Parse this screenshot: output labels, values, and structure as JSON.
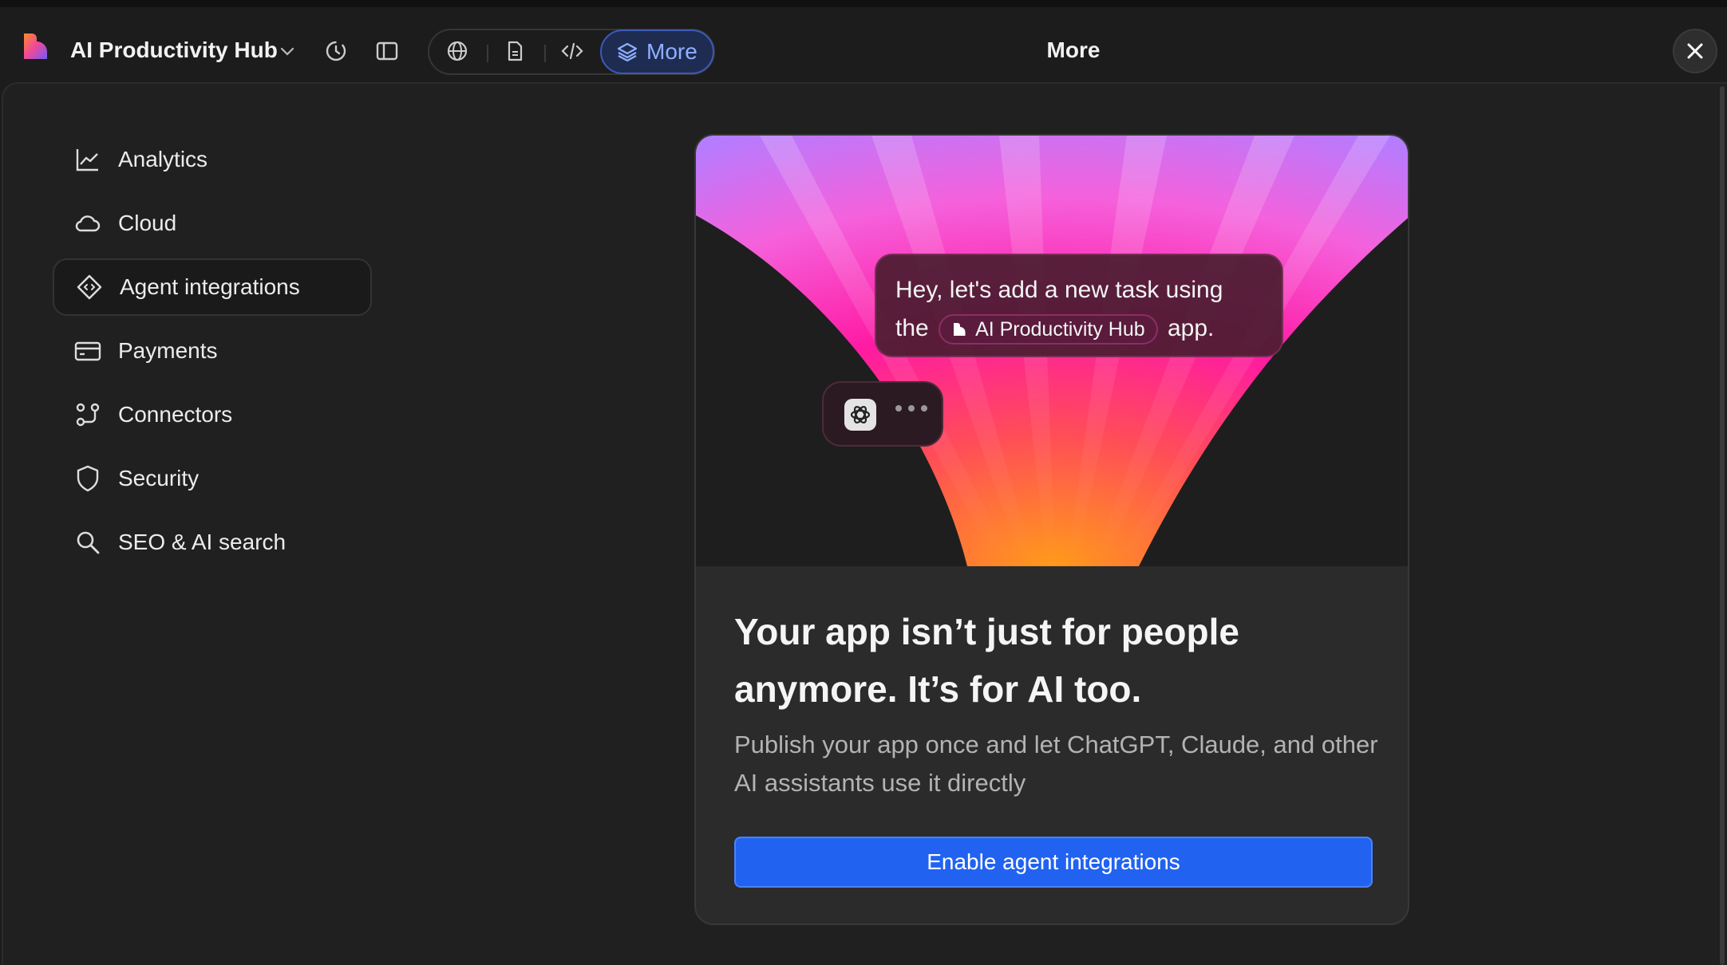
{
  "app": {
    "title": "AI Productivity Hub",
    "brand_colors": [
      "#f0489a",
      "#ff8a2b",
      "#6f5cf6"
    ]
  },
  "toolbar": {
    "icons": [
      "history-icon",
      "sidebar-toggle-icon",
      "globe-icon",
      "document-icon",
      "code-icon",
      "layers-icon"
    ],
    "more_label": "More",
    "accent": "#3b5ab8"
  },
  "header": {
    "title": "More"
  },
  "sidebar": {
    "items": [
      {
        "label": "Analytics",
        "icon": "chart-line-icon"
      },
      {
        "label": "Cloud",
        "icon": "cloud-icon"
      },
      {
        "label": "Agent integrations",
        "icon": "diamond-code-icon",
        "active": true
      },
      {
        "label": "Payments",
        "icon": "credit-card-icon"
      },
      {
        "label": "Connectors",
        "icon": "connectors-icon"
      },
      {
        "label": "Security",
        "icon": "shield-icon"
      },
      {
        "label": "SEO & AI search",
        "icon": "search-icon"
      }
    ]
  },
  "card": {
    "chat": {
      "line1": "Hey, let's add a new task using",
      "before_chip": "the",
      "chip": "AI Productivity Hub",
      "after_chip": "app."
    },
    "headline_1": "Your app isn’t just for people",
    "headline_2": "anymore. It’s for AI too.",
    "description_1": "Publish your app once and let ChatGPT, Claude, and other",
    "description_2": "AI assistants use it directly",
    "cta": "Enable agent integrations",
    "cta_color": "#2163f0"
  }
}
